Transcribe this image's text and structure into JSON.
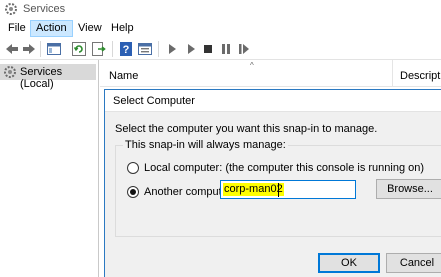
{
  "window": {
    "title": "Services"
  },
  "menu": {
    "items": [
      "File",
      "Action",
      "View",
      "Help"
    ],
    "active": "Action"
  },
  "toolbar": {
    "icons": [
      "back-arrow-icon",
      "forward-arrow-icon",
      "show-hide-tree-icon",
      "refresh-icon",
      "export-list-icon",
      "help-icon",
      "properties-icon",
      "play-icon",
      "play-alt-icon",
      "stop-icon",
      "pause-icon",
      "restart-icon"
    ]
  },
  "tree": {
    "root_label": "Services (Local)"
  },
  "list": {
    "columns": [
      "Name",
      "Descripti"
    ]
  },
  "dialog": {
    "title": "Select Computer",
    "intro": "Select the computer you want this snap-in to manage.",
    "group_label": "This snap-in will always manage:",
    "local_option": "Local computer:  (the computer this console is running on)",
    "another_option": "Another computer:",
    "selected": "another",
    "computer_name": "corp-man02",
    "browse_label": "Browse...",
    "ok_label": "OK",
    "cancel_label": "Cancel"
  },
  "colors": {
    "accent": "#0078d7",
    "selection": "#cce8ff",
    "highlight": "#ffff00",
    "dialog_bg": "#f0f0f0"
  }
}
